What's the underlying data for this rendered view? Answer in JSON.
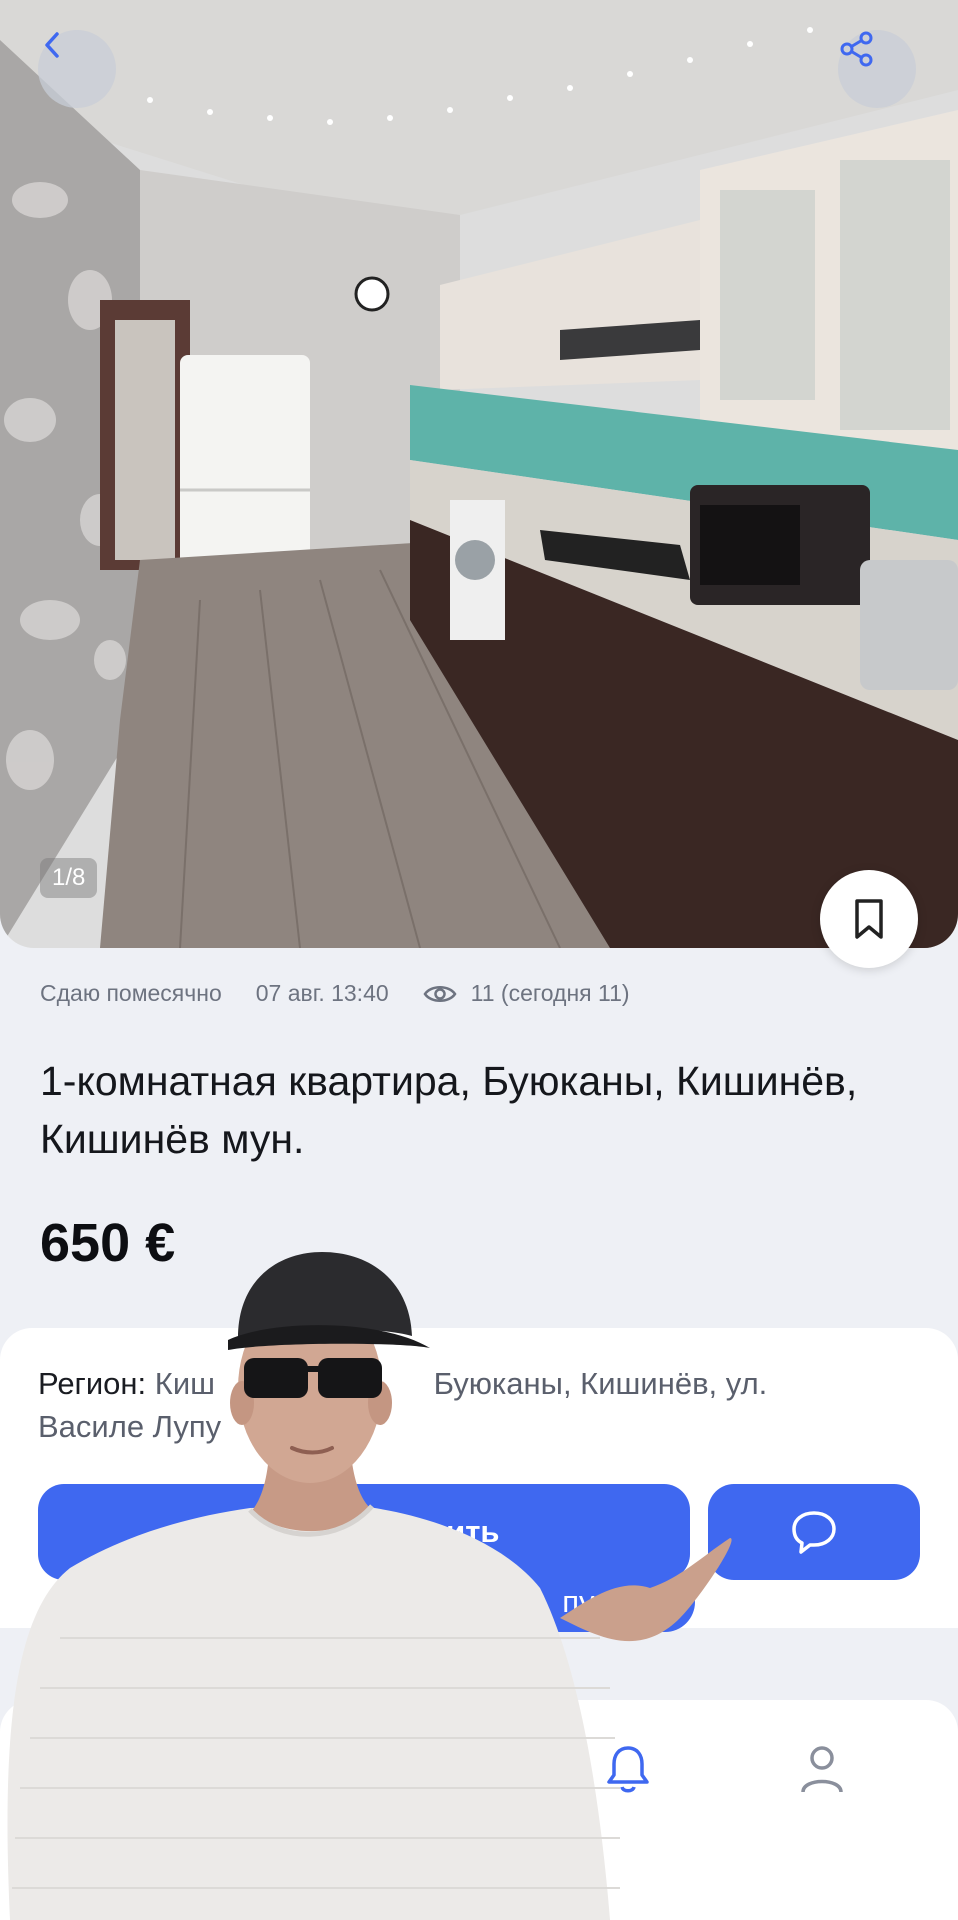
{
  "gallery": {
    "counter": "1/8"
  },
  "listing": {
    "rent_type": "Сдаю помесячно",
    "date": "07 авг. 13:40",
    "views": "11 (сегодня 11)",
    "title": "1-комнатная квартира,  Буюканы, Кишинёв,  Кишинёв мун.",
    "price": "650 €"
  },
  "details": {
    "region_label": "Регион: ",
    "region_value_left": "Киш",
    "region_value_right": "Буюканы, Кишинёв, ул.",
    "region_value_line2": "Василе Лупу"
  },
  "actions": {
    "call_label": "онить",
    "address_chip": "пу, 42/3"
  },
  "colors": {
    "accent": "#3f68f0",
    "background": "#eef0f5"
  },
  "icons": {
    "back": "chevron-left-icon",
    "share": "share-icon",
    "bookmark": "bookmark-icon",
    "eye": "eye-icon",
    "chat": "chat-icon",
    "bell": "bell-icon",
    "profile": "user-icon"
  }
}
